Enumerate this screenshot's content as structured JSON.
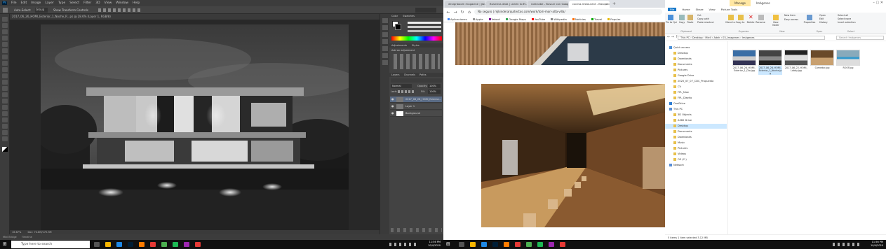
{
  "photoshop": {
    "app_badge": "Ps",
    "menu": [
      "File",
      "Edit",
      "Image",
      "Layer",
      "Type",
      "Select",
      "Filter",
      "3D",
      "View",
      "Window",
      "Help"
    ],
    "options_bar": [
      "Auto-Select:",
      "Group",
      "Show Transform Controls"
    ],
    "document_tab": "2017_06_26_HOMI_Exterior_1_Noche_R...ps @ 28.6% (Layer 1, RGB/8)",
    "status": {
      "zoom": "16.67%",
      "doc": "Doc: 74.8M/170.3M"
    },
    "timeline_tabs": [
      "Mini Bridge",
      "Timeline"
    ],
    "panel_tabs": {
      "color": [
        "Color",
        "Swatches"
      ],
      "adjust": [
        "Adjustments",
        "Styles"
      ],
      "layers": [
        "Layers",
        "Channels",
        "Paths"
      ]
    },
    "layer_controls": {
      "blend": "Normal",
      "opacity_label": "Opacity:",
      "opacity": "100%",
      "lock_label": "Lock:",
      "fill_label": "Fill:",
      "fill": "100%"
    },
    "adjust_hint": "Add an adjustment",
    "layers": [
      {
        "name": "2017_06_26_HOMI_Exterior...",
        "selected": true
      },
      {
        "name": "Layer 1",
        "selected": false
      },
      {
        "name": "Background",
        "selected": false
      }
    ]
  },
  "chrome": {
    "tabs": [
      {
        "title": "designboom magazine | your fi...",
        "active": false
      },
      {
        "title": "Business data | Listen to Fr...",
        "active": false
      },
      {
        "title": "noticiabe - Buscar con Google",
        "active": false
      },
      {
        "title": "cocina-restaurant - Búsqueda de...",
        "active": true
      }
    ],
    "url": "No seguro | mjkinderarquitectos.com/work/torii-mori-alta-villa/",
    "bookmarks": [
      "Aplicaciones",
      "Apple",
      "Yahoo!",
      "Google Maps",
      "YouTube",
      "Wikipedia",
      "Noticias",
      "Travel",
      "Popular"
    ]
  },
  "explorer": {
    "title_ribbon_group": "Manage",
    "title": "Imágenes",
    "tabs": [
      "File",
      "Home",
      "Share",
      "View",
      "Picture Tools"
    ],
    "ribbon": {
      "pin": "Pin to Quick access",
      "copy": "Copy",
      "paste": "Paste",
      "cut": "Cut",
      "copy_path": "Copy path",
      "paste_shortcut": "Paste shortcut",
      "move_to": "Move to",
      "copy_to": "Copy to",
      "delete": "Delete",
      "rename": "Rename",
      "new_folder": "New folder",
      "new_item": "New item",
      "easy_access": "Easy access",
      "properties": "Properties",
      "open": "Open",
      "edit": "Edit",
      "history": "History",
      "select_all": "Select all",
      "select_none": "Select none",
      "invert": "Invert selection",
      "groups": [
        "Clipboard",
        "Organize",
        "New",
        "Open",
        "Select"
      ]
    },
    "breadcrumb": "This PC  ›  Desktop  ›  Mieli  ›  Adek  ›  03_Imagenes  ›  Imágenes",
    "search_placeholder": "Search Imágenes",
    "nav": [
      {
        "label": "Quick access",
        "indent": 0
      },
      {
        "label": "Desktop",
        "indent": 1
      },
      {
        "label": "Downloads",
        "indent": 1
      },
      {
        "label": "Documents",
        "indent": 1
      },
      {
        "label": "Pictures",
        "indent": 1
      },
      {
        "label": "Google Drive",
        "indent": 1
      },
      {
        "label": "2020_07_07_CDC_Propuesta",
        "indent": 1
      },
      {
        "label": "CV",
        "indent": 1
      },
      {
        "label": "FPL_Nixe",
        "indent": 1
      },
      {
        "label": "FPL_Diseño",
        "indent": 1
      },
      {
        "label": "OneDrive",
        "indent": 0
      },
      {
        "label": "This PC",
        "indent": 0
      },
      {
        "label": "3D Objects",
        "indent": 1
      },
      {
        "label": "A360 Drive",
        "indent": 1
      },
      {
        "label": "Desktop",
        "indent": 1,
        "selected": true
      },
      {
        "label": "Documents",
        "indent": 1
      },
      {
        "label": "Downloads",
        "indent": 1
      },
      {
        "label": "Music",
        "indent": 1
      },
      {
        "label": "Pictures",
        "indent": 1
      },
      {
        "label": "Videos",
        "indent": 1
      },
      {
        "label": "OS (C:)",
        "indent": 1
      },
      {
        "label": "Network",
        "indent": 0
      }
    ],
    "files": [
      {
        "name": "2017_06_26_HOMI_Exterior_1_Dia.jpg"
      },
      {
        "name": "2017_06_26_HOMI_Exterior_1_Noche.jpg",
        "selected": true
      },
      {
        "name": "2017_06_22_HOMI_Lobby.jpg"
      },
      {
        "name": "Comedor.jpg"
      },
      {
        "name": "ROOF.jpg"
      }
    ],
    "status": "5 items    1 item selected  3.12 MB"
  },
  "taskbar": {
    "search_placeholder": "Type here to search",
    "clock_left": {
      "time": "11:56 PM",
      "date": "10/4/2020"
    },
    "clock_right": {
      "time": "11:56 PM",
      "date": "10/4/2020"
    }
  },
  "colors": {
    "ps_bg": "#535353",
    "ps_panel": "#434343",
    "selection": "#cce8ff",
    "accent": "#0078d7"
  }
}
